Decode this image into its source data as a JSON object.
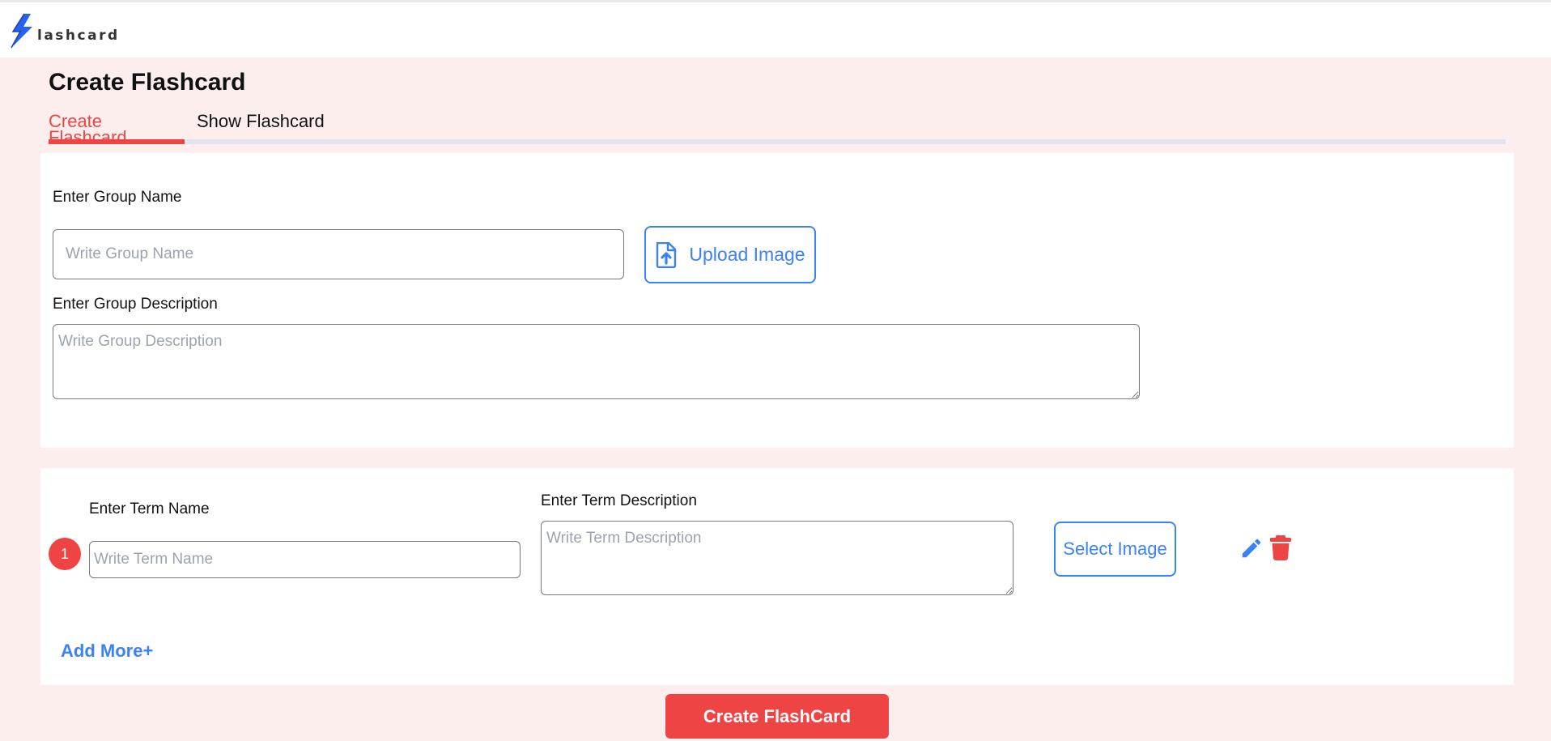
{
  "app": {
    "logo_text": "lashcard"
  },
  "page": {
    "title": "Create Flashcard"
  },
  "tabs": [
    {
      "label": "Create Flashcard",
      "active": true
    },
    {
      "label": "Show Flashcard",
      "active": false
    }
  ],
  "group": {
    "name_label": "Enter Group Name",
    "name_placeholder": "Write Group Name",
    "upload_label": "Upload Image",
    "description_label": "Enter Group Description",
    "description_placeholder": "Write Group Description"
  },
  "terms": [
    {
      "number": "1",
      "name_label": "Enter Term Name",
      "name_placeholder": "Write Term Name",
      "description_label": "Enter Term Description",
      "description_placeholder": "Write Term Description",
      "select_image_label": "Select Image",
      "edit_icon": "pencil-icon",
      "delete_icon": "trash-icon"
    }
  ],
  "actions": {
    "add_more_label": "Add More+",
    "create_label": "Create FlashCard"
  },
  "colors": {
    "accent_red": "#ef4444",
    "accent_blue": "#3b82f6",
    "page_background": "#fdeeee"
  }
}
